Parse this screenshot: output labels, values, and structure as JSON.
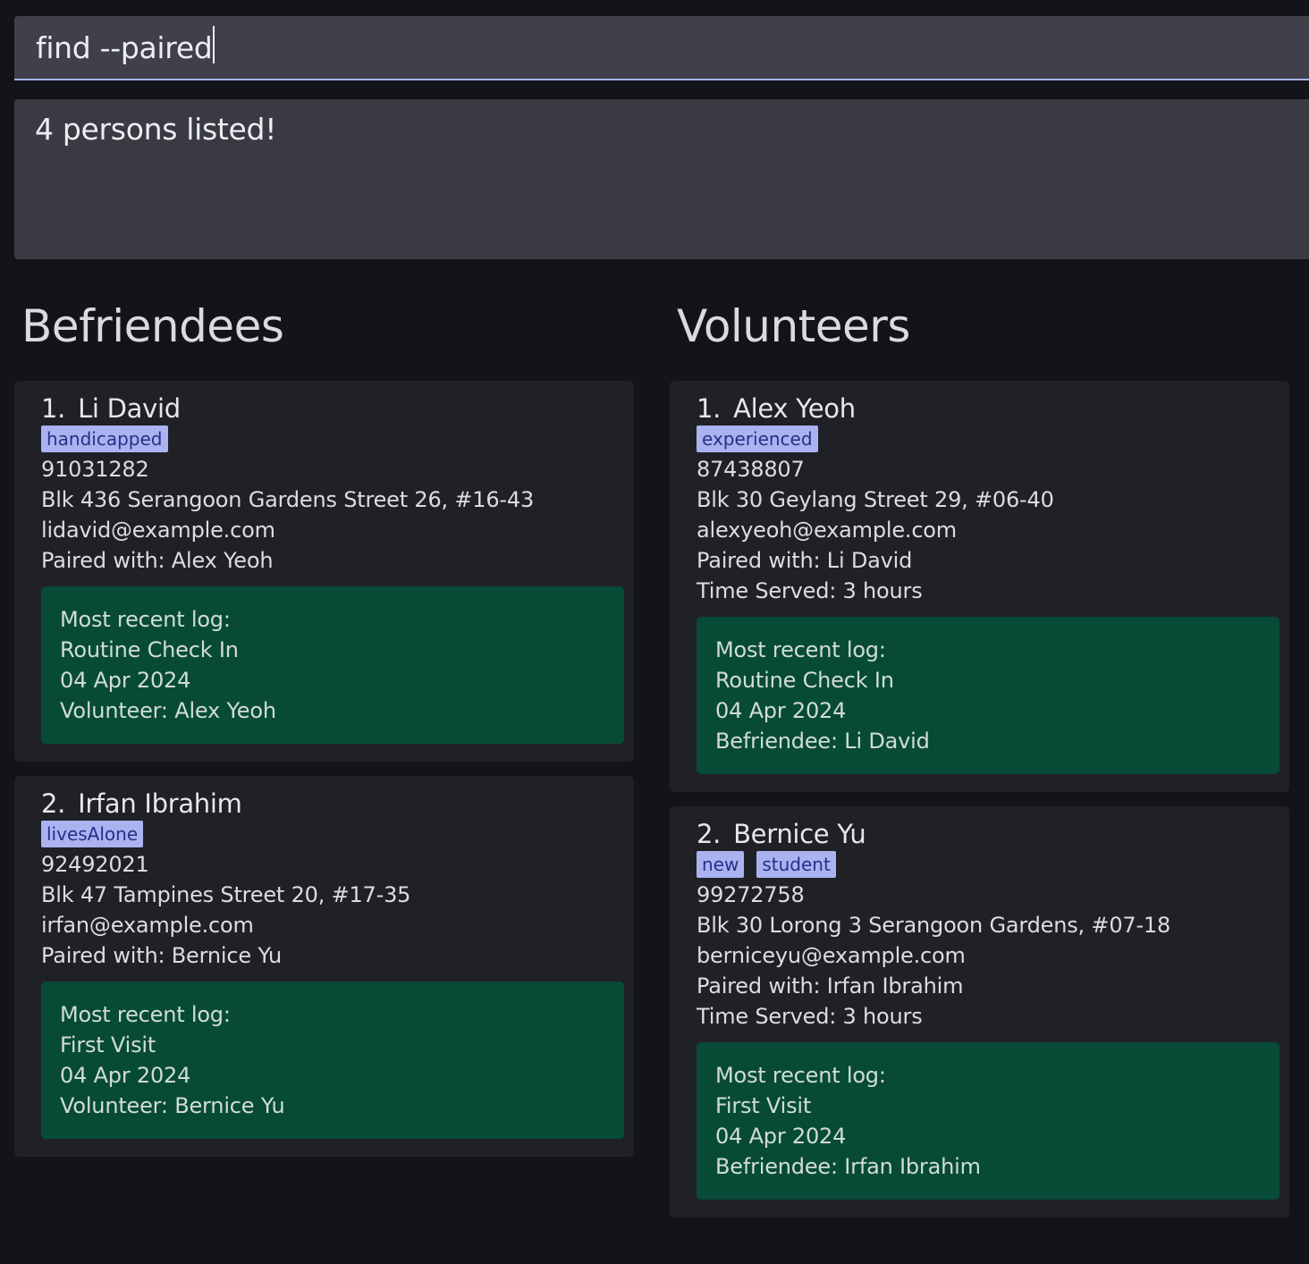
{
  "command": {
    "value": "find --paired"
  },
  "result": {
    "message": "4 persons listed!"
  },
  "befriendees": {
    "title": "Befriendees",
    "items": [
      {
        "index": "1.",
        "name": "Li David",
        "tags": [
          "handicapped"
        ],
        "phone": "91031282",
        "address": "Blk 436 Serangoon Gardens Street 26, #16-43",
        "email": "lidavid@example.com",
        "paired": "Paired with: Alex Yeoh",
        "log": {
          "heading": "Most recent log:",
          "title": "Routine Check In",
          "date": "04 Apr 2024",
          "who": "Volunteer: Alex Yeoh"
        }
      },
      {
        "index": "2.",
        "name": "Irfan Ibrahim",
        "tags": [
          "livesAlone"
        ],
        "phone": "92492021",
        "address": "Blk 47 Tampines Street 20, #17-35",
        "email": "irfan@example.com",
        "paired": "Paired with: Bernice Yu",
        "log": {
          "heading": "Most recent log:",
          "title": "First Visit",
          "date": "04 Apr 2024",
          "who": "Volunteer: Bernice Yu"
        }
      }
    ]
  },
  "volunteers": {
    "title": "Volunteers",
    "items": [
      {
        "index": "1.",
        "name": "Alex Yeoh",
        "tags": [
          "experienced"
        ],
        "phone": "87438807",
        "address": "Blk 30 Geylang Street 29, #06-40",
        "email": "alexyeoh@example.com",
        "paired": "Paired with: Li David",
        "time_served": "Time Served: 3 hours",
        "log": {
          "heading": "Most recent log:",
          "title": "Routine Check In",
          "date": "04 Apr 2024",
          "who": "Befriendee: Li David"
        }
      },
      {
        "index": "2.",
        "name": "Bernice Yu",
        "tags": [
          "new",
          "student"
        ],
        "phone": "99272758",
        "address": "Blk 30 Lorong 3 Serangoon Gardens, #07-18",
        "email": "berniceyu@example.com",
        "paired": "Paired with: Irfan Ibrahim",
        "time_served": "Time Served: 3 hours",
        "log": {
          "heading": "Most recent log:",
          "title": "First Visit",
          "date": "04 Apr 2024",
          "who": "Befriendee: Irfan Ibrahim"
        }
      }
    ]
  },
  "colors": {
    "background": "#131419",
    "card": "#202027",
    "log_panel": "#074b37",
    "tag_bg": "#aab3f0",
    "tag_text": "#2a2e88",
    "input_underline": "#a9b4ee"
  }
}
